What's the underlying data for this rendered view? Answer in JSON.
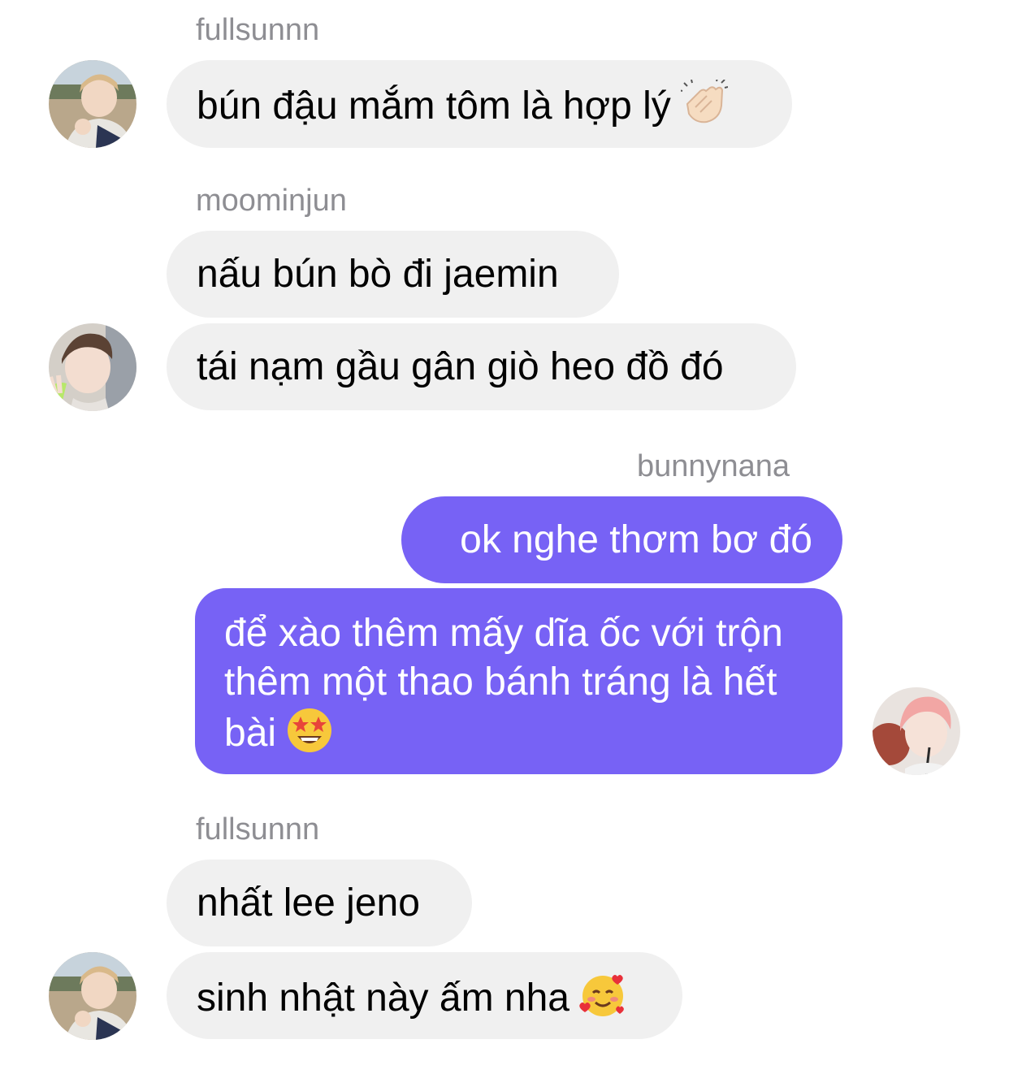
{
  "messages": [
    {
      "sender": "fullsunnn",
      "text": "bún đậu mắm tôm là hợp lý",
      "emoji": "clapping-hands-emoji"
    },
    {
      "sender": "moominjun",
      "text": "nấu bún bò đi jaemin"
    },
    {
      "text": "tái nạm gầu gân giò heo đồ đó"
    },
    {
      "sender": "bunnynana",
      "text": "ok nghe thơm bơ đó"
    },
    {
      "text": "để xào thêm mấy dĩa ốc với trộn thêm một thao bánh tráng là hết bài",
      "emoji": "star-struck-emoji"
    },
    {
      "sender": "fullsunnn",
      "text": "nhất lee jeno"
    },
    {
      "text": "sinh nhật này ấm nha",
      "emoji": "smiling-face-with-hearts-emoji"
    }
  ],
  "colors": {
    "outgoing_bubble": "#7762f5",
    "incoming_bubble": "#f0f0f0",
    "sender_name": "#8e8e93"
  }
}
